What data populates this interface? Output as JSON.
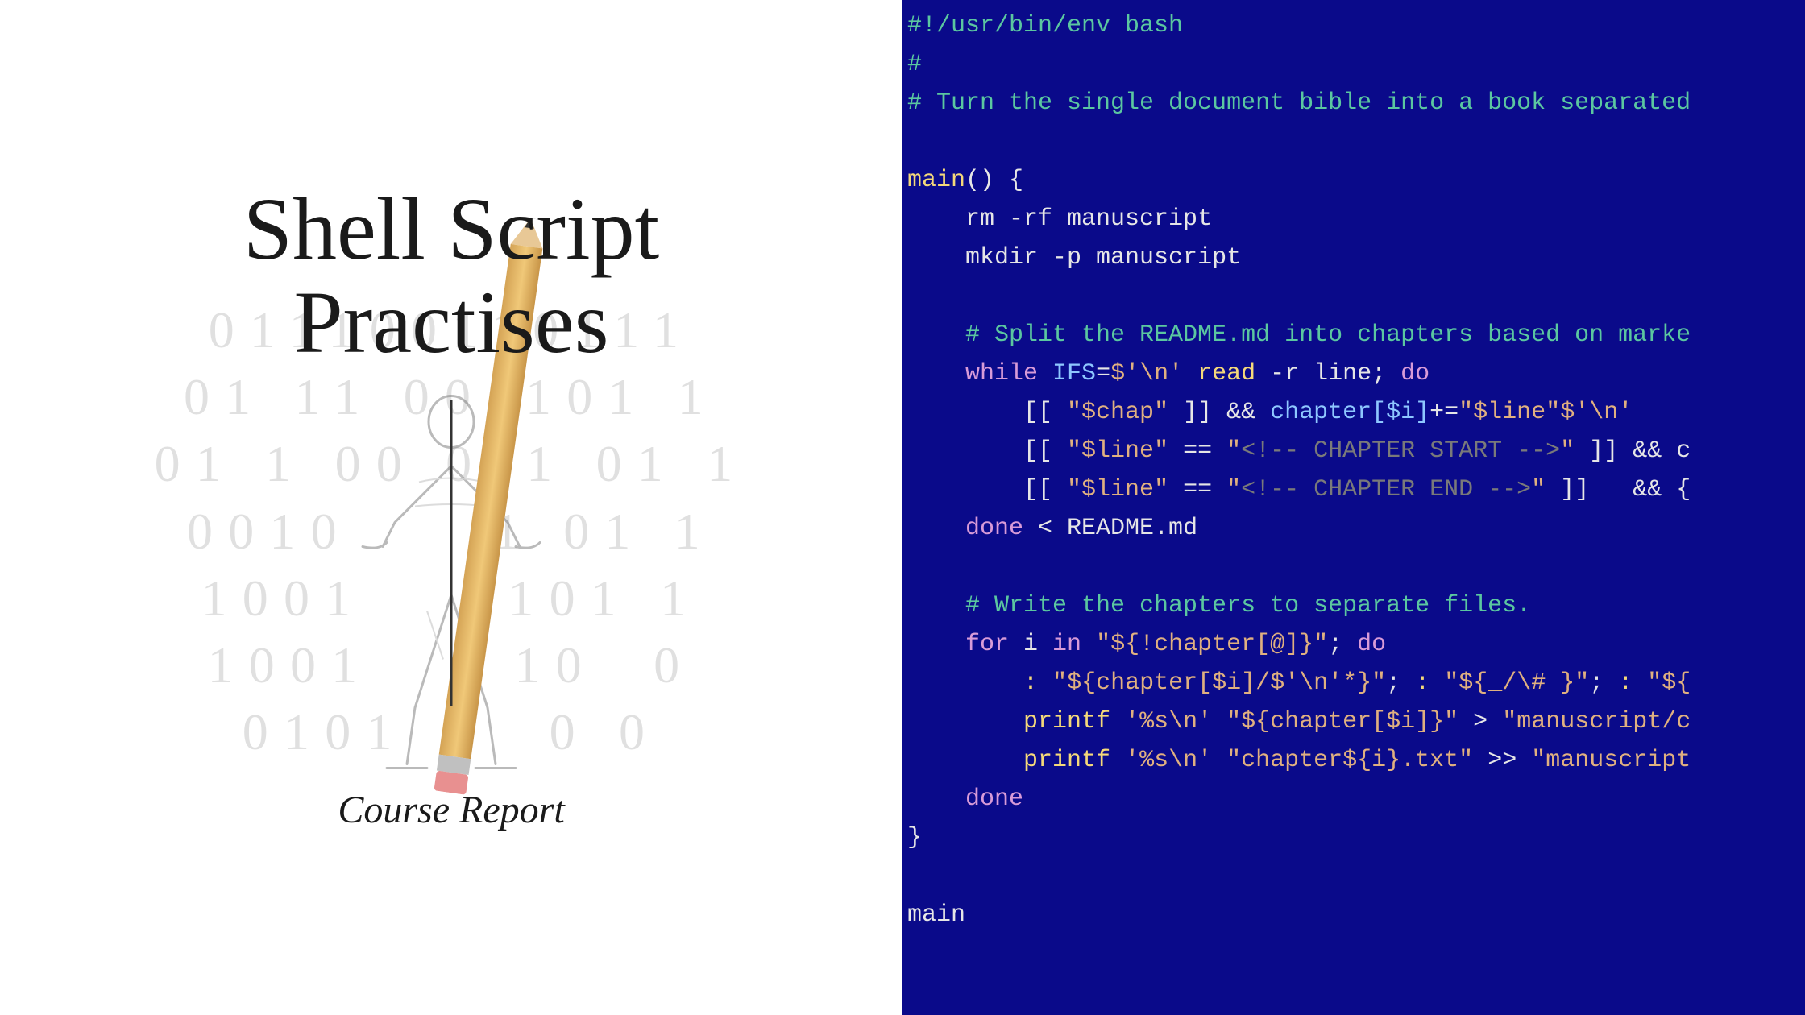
{
  "left": {
    "title_line1": "Shell Script",
    "title_line2": "Practises",
    "subtitle": "Course Report",
    "binary_rows": [
      "011100110111",
      "01 11 001101 1",
      "01 1 00 011 01 1",
      "0010     1 01 1",
      "1001     101 1",
      "1001     10  0",
      "0101     0 0"
    ]
  },
  "code": {
    "lines": [
      {
        "t": "shebang",
        "text": "#!/usr/bin/env bash"
      },
      {
        "t": "comment",
        "text": "#"
      },
      {
        "t": "comment",
        "text": "# Turn the single document bible into a book separated"
      },
      {
        "t": "blank",
        "text": ""
      },
      {
        "t": "funcdef",
        "name": "main",
        "suffix": "() {"
      },
      {
        "t": "plain",
        "indent": 1,
        "segs": [
          {
            "c": "punct",
            "v": "rm -rf manuscript"
          }
        ]
      },
      {
        "t": "plain",
        "indent": 1,
        "segs": [
          {
            "c": "punct",
            "v": "mkdir -p manuscript"
          }
        ]
      },
      {
        "t": "blank",
        "text": ""
      },
      {
        "t": "comment",
        "indent": 1,
        "text": "# Split the README.md into chapters based on marke"
      },
      {
        "t": "plain",
        "indent": 1,
        "segs": [
          {
            "c": "keyword",
            "v": "while"
          },
          {
            "c": "punct",
            "v": " "
          },
          {
            "c": "var",
            "v": "IFS"
          },
          {
            "c": "punct",
            "v": "="
          },
          {
            "c": "string",
            "v": "$'\\n'"
          },
          {
            "c": "punct",
            "v": " "
          },
          {
            "c": "func",
            "v": "read"
          },
          {
            "c": "punct",
            "v": " -r line; "
          },
          {
            "c": "keyword",
            "v": "do"
          }
        ]
      },
      {
        "t": "plain",
        "indent": 2,
        "segs": [
          {
            "c": "punct",
            "v": "[[ "
          },
          {
            "c": "string",
            "v": "\"$chap\""
          },
          {
            "c": "punct",
            "v": " ]] && "
          },
          {
            "c": "var",
            "v": "chapter[$i]"
          },
          {
            "c": "punct",
            "v": "+="
          },
          {
            "c": "string",
            "v": "\"$line\""
          },
          {
            "c": "string",
            "v": "$'\\n'"
          }
        ]
      },
      {
        "t": "plain",
        "indent": 2,
        "segs": [
          {
            "c": "punct",
            "v": "[[ "
          },
          {
            "c": "string",
            "v": "\"$line\""
          },
          {
            "c": "punct",
            "v": " == "
          },
          {
            "c": "string",
            "v": "\""
          },
          {
            "c": "tag",
            "v": "<!-- CHAPTER START -->"
          },
          {
            "c": "string",
            "v": "\""
          },
          {
            "c": "punct",
            "v": " ]] && c"
          }
        ]
      },
      {
        "t": "plain",
        "indent": 2,
        "segs": [
          {
            "c": "punct",
            "v": "[[ "
          },
          {
            "c": "string",
            "v": "\"$line\""
          },
          {
            "c": "punct",
            "v": " == "
          },
          {
            "c": "string",
            "v": "\""
          },
          {
            "c": "tag",
            "v": "<!-- CHAPTER END -->"
          },
          {
            "c": "string",
            "v": "\""
          },
          {
            "c": "punct",
            "v": " ]]   && "
          },
          {
            "c": "bracket",
            "v": "{"
          }
        ]
      },
      {
        "t": "plain",
        "indent": 1,
        "segs": [
          {
            "c": "keyword",
            "v": "done"
          },
          {
            "c": "punct",
            "v": " < README.md"
          }
        ]
      },
      {
        "t": "blank",
        "text": ""
      },
      {
        "t": "comment",
        "indent": 1,
        "text": "# Write the chapters to separate files."
      },
      {
        "t": "plain",
        "indent": 1,
        "segs": [
          {
            "c": "keyword",
            "v": "for"
          },
          {
            "c": "punct",
            "v": " i "
          },
          {
            "c": "keyword",
            "v": "in"
          },
          {
            "c": "punct",
            "v": " "
          },
          {
            "c": "string",
            "v": "\"${!chapter[@]}\""
          },
          {
            "c": "punct",
            "v": "; "
          },
          {
            "c": "keyword",
            "v": "do"
          }
        ]
      },
      {
        "t": "plain",
        "indent": 2,
        "segs": [
          {
            "c": "func",
            "v": ":"
          },
          {
            "c": "punct",
            "v": " "
          },
          {
            "c": "string",
            "v": "\"${chapter[$i]/$'\\n'*}\""
          },
          {
            "c": "punct",
            "v": "; "
          },
          {
            "c": "func",
            "v": ":"
          },
          {
            "c": "punct",
            "v": " "
          },
          {
            "c": "string",
            "v": "\"${_/\\# }\""
          },
          {
            "c": "punct",
            "v": "; "
          },
          {
            "c": "func",
            "v": ":"
          },
          {
            "c": "punct",
            "v": " "
          },
          {
            "c": "string",
            "v": "\"${"
          }
        ]
      },
      {
        "t": "plain",
        "indent": 2,
        "segs": [
          {
            "c": "func",
            "v": "printf"
          },
          {
            "c": "punct",
            "v": " "
          },
          {
            "c": "string",
            "v": "'%s\\n'"
          },
          {
            "c": "punct",
            "v": " "
          },
          {
            "c": "string",
            "v": "\"${chapter[$i]}\""
          },
          {
            "c": "punct",
            "v": " > "
          },
          {
            "c": "string",
            "v": "\"manuscript/c"
          }
        ]
      },
      {
        "t": "plain",
        "indent": 2,
        "segs": [
          {
            "c": "func",
            "v": "printf"
          },
          {
            "c": "punct",
            "v": " "
          },
          {
            "c": "string",
            "v": "'%s\\n'"
          },
          {
            "c": "punct",
            "v": " "
          },
          {
            "c": "string",
            "v": "\"chapter${i}.txt\""
          },
          {
            "c": "punct",
            "v": " >> "
          },
          {
            "c": "string",
            "v": "\"manuscript"
          }
        ]
      },
      {
        "t": "plain",
        "indent": 1,
        "segs": [
          {
            "c": "keyword",
            "v": "done"
          }
        ]
      },
      {
        "t": "plain",
        "indent": 0,
        "segs": [
          {
            "c": "bracket",
            "v": "}"
          }
        ]
      },
      {
        "t": "blank",
        "text": ""
      },
      {
        "t": "plain",
        "indent": 0,
        "segs": [
          {
            "c": "punct",
            "v": "main"
          }
        ]
      }
    ]
  }
}
